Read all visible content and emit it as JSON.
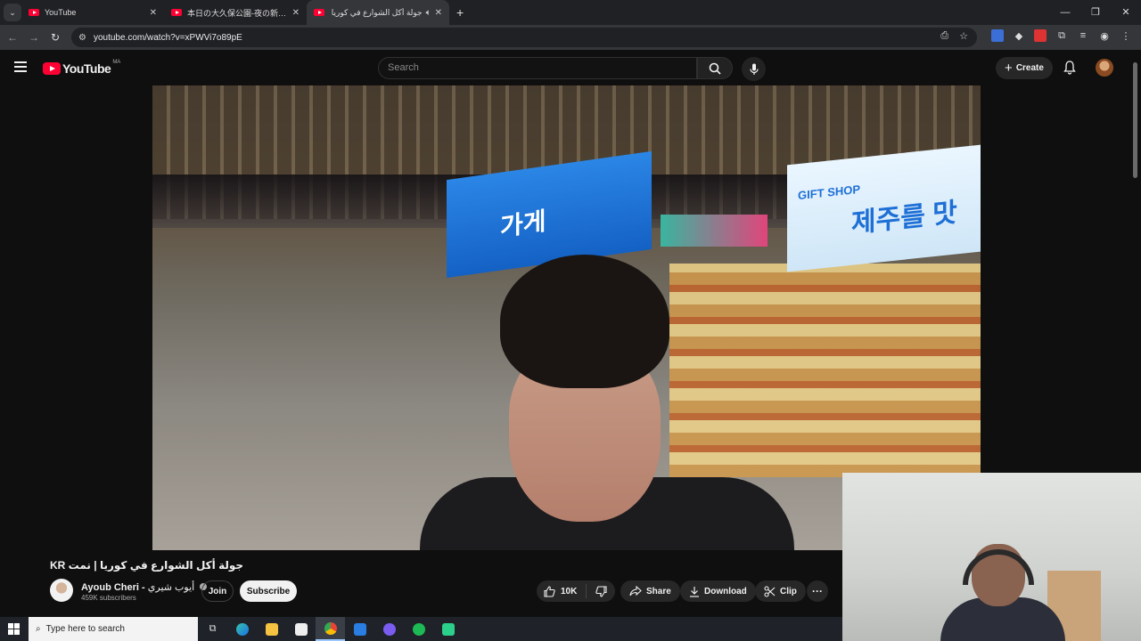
{
  "browser": {
    "tabs": [
      {
        "title": "YouTube",
        "active": false
      },
      {
        "title": "本日の大久保公園-夜の新宿歌舞伎町",
        "active": false
      },
      {
        "title": "جولة أكل الشوارع في كوريا",
        "active": true
      }
    ],
    "new_tab": "+",
    "url": "youtube.com/watch?v=xPWVi7o89pE"
  },
  "header": {
    "logo_text": "YouTube",
    "country_code": "MA",
    "search_placeholder": "Search",
    "create_label": "Create"
  },
  "video": {
    "title": "جولة أكل الشوارع في كوريا | نمت KR",
    "sign_big": "제주를 맛",
    "sign_small": "GIFT SHOP",
    "sign_blue": "가게",
    "channel": {
      "name": "Ayoub Cheri -",
      "name_ar": "أيوب شيري",
      "subscribers": "459K subscribers"
    },
    "join_label": "Join",
    "subscribe_label": "Subscribe",
    "likes": "10K",
    "share_label": "Share",
    "download_label": "Download",
    "clip_label": "Clip"
  },
  "taskbar": {
    "search_placeholder": "Type here to search"
  },
  "colors": {
    "accent": "#ff0033",
    "bg": "#0f0f0f"
  }
}
